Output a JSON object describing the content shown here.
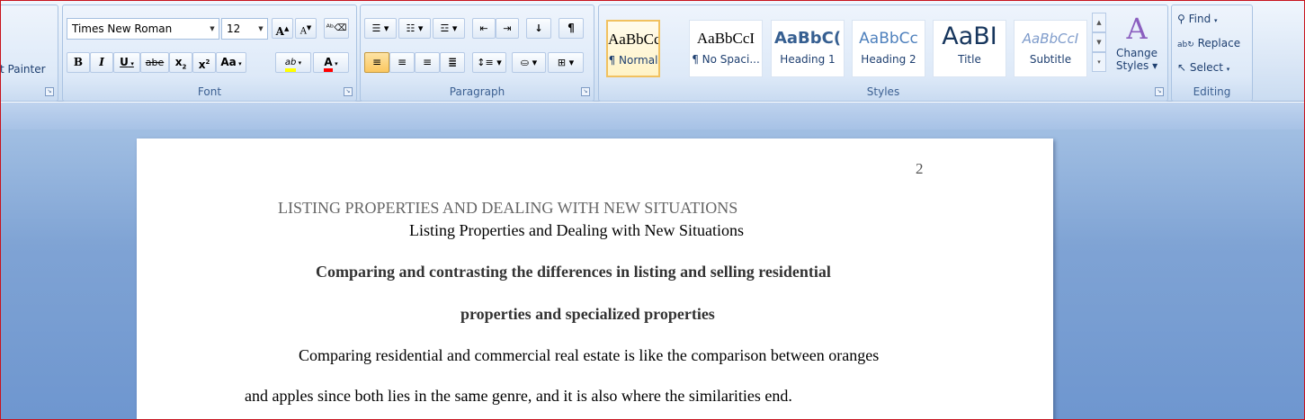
{
  "clipboard": {
    "format_painter": "t Painter"
  },
  "font": {
    "name": "Times New Roman",
    "size": "12",
    "group_label": "Font",
    "grow": "A",
    "shrink": "A",
    "bold": "B",
    "italic": "I",
    "underline": "U",
    "strike": "abe",
    "subscript": "x",
    "superscript": "x",
    "case": "Aa",
    "highlight": "ab",
    "color": "A"
  },
  "paragraph": {
    "group_label": "Paragraph",
    "pilcrow": "¶"
  },
  "styles": {
    "group_label": "Styles",
    "items": [
      {
        "preview": "AaBbCcI",
        "name": "¶ Normal"
      },
      {
        "preview": "AaBbCcI",
        "name": "¶ No Spaci..."
      },
      {
        "preview": "AaBbC(",
        "name": "Heading 1"
      },
      {
        "preview": "AaBbCc",
        "name": "Heading 2"
      },
      {
        "preview": "AaBI",
        "name": "Title"
      },
      {
        "preview": "AaBbCcI",
        "name": "Subtitle"
      }
    ],
    "change_line1": "Change",
    "change_line2": "Styles"
  },
  "editing": {
    "group_label": "Editing",
    "find": "Find",
    "replace": "Replace",
    "select": "Select"
  },
  "document": {
    "page_number": "2",
    "running_head": "LISTING PROPERTIES AND DEALING WITH NEW SITUATIONS",
    "title": "Listing Properties and Dealing with New Situations",
    "heading_line1": "Comparing and contrasting the differences in listing and selling residential",
    "heading_line2": "properties and specialized properties",
    "para_line1": "Comparing residential and commercial real estate is like the comparison between oranges",
    "para_line2": "and apples since both lies in the same genre, and it is also where the similarities end."
  },
  "colors": {
    "accent": "#15428b",
    "highlight": "#ffff00",
    "font_color": "#ff0000",
    "frame": "#c8141d"
  }
}
